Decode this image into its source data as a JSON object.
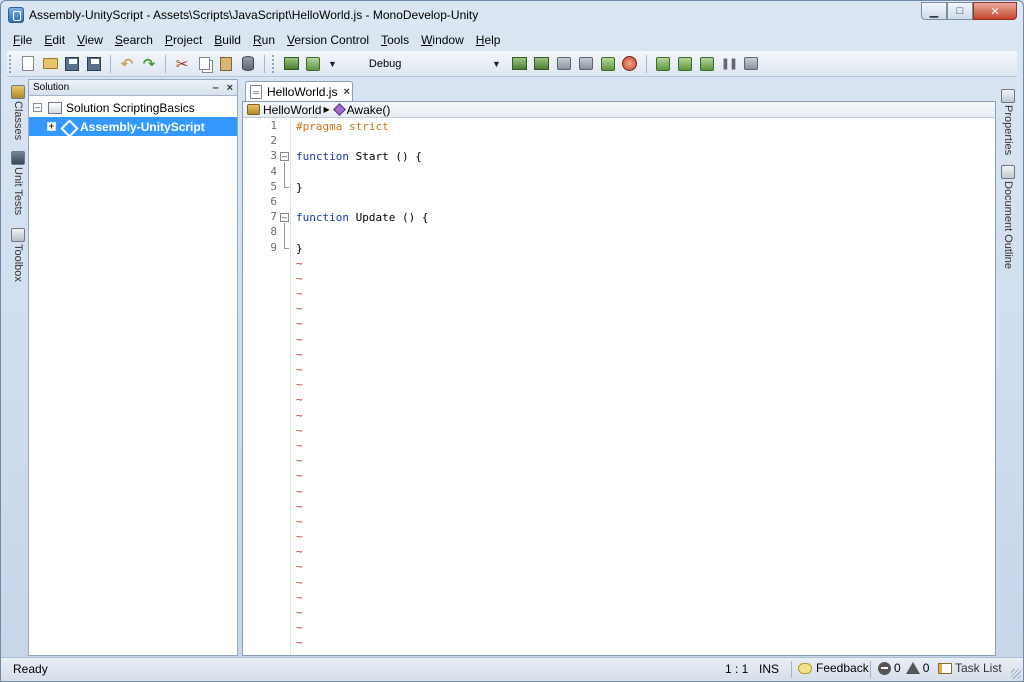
{
  "window": {
    "title": "Assembly-UnityScript - Assets\\Scripts\\JavaScript\\HelloWorld.js - MonoDevelop-Unity",
    "minimize_glyph": "▁",
    "maximize_glyph": "□",
    "close_glyph": "✕"
  },
  "menu": [
    "File",
    "Edit",
    "View",
    "Search",
    "Project",
    "Build",
    "Run",
    "Version Control",
    "Tools",
    "Window",
    "Help"
  ],
  "toolbar": {
    "configuration": "Debug",
    "undo_glyph": "↶",
    "redo_glyph": "↷",
    "cut_glyph": "✂",
    "pause_glyph": "❚❚"
  },
  "left_dock": {
    "tabs": [
      "Classes",
      "Unit Tests",
      "Toolbox"
    ]
  },
  "solution_pane": {
    "title": "Solution",
    "minimize_glyph": "–",
    "close_glyph": "×",
    "solution_node": "Solution ScriptingBasics",
    "solution_expander": "–",
    "project_node": "Assembly-UnityScript",
    "project_expander": "+"
  },
  "editor": {
    "tab_label": "HelloWorld.js",
    "tab_close": "×",
    "breadcrumb": {
      "class_name": "HelloWorld",
      "separator": "▶",
      "method_name": "Awake()"
    },
    "lines": [
      {
        "num": "1",
        "parts": [
          {
            "cls": "kw-pragma",
            "text": "#pragma strict"
          }
        ]
      },
      {
        "num": "2",
        "parts": []
      },
      {
        "num": "3",
        "fold": "open",
        "parts": [
          {
            "cls": "kw-fn",
            "text": "function"
          },
          {
            "cls": "",
            "text": " Start () {"
          }
        ]
      },
      {
        "num": "4",
        "parts": []
      },
      {
        "num": "5",
        "fold": "end",
        "parts": [
          {
            "cls": "",
            "text": "}"
          }
        ]
      },
      {
        "num": "6",
        "parts": []
      },
      {
        "num": "7",
        "fold": "open",
        "parts": [
          {
            "cls": "kw-fn",
            "text": "function"
          },
          {
            "cls": "",
            "text": " Update () {"
          }
        ]
      },
      {
        "num": "8",
        "parts": []
      },
      {
        "num": "9",
        "fold": "end",
        "parts": [
          {
            "cls": "",
            "text": "}"
          }
        ]
      }
    ],
    "fold_glyph": "–",
    "empty_line_marker": "~",
    "empty_line_count": 26
  },
  "right_dock": {
    "tabs": [
      "Properties",
      "Document Outline"
    ]
  },
  "status": {
    "text": "Ready",
    "position": "1 : 1",
    "mode": "INS",
    "feedback": "Feedback",
    "errors": "0",
    "warnings": "0",
    "task_list": "Task List"
  }
}
